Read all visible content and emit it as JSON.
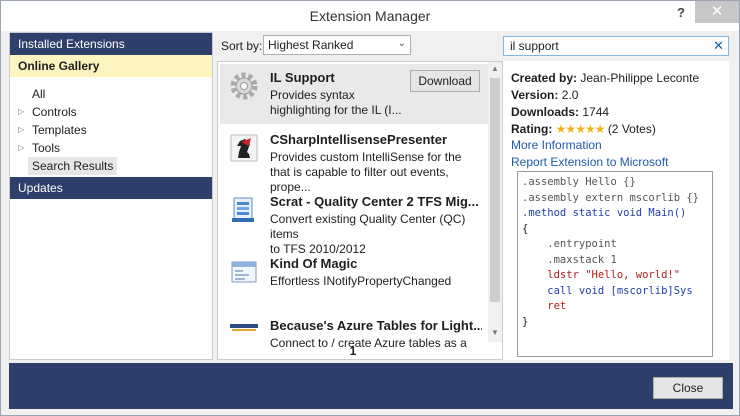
{
  "window": {
    "title": "Extension Manager",
    "help": "?",
    "close": "✕"
  },
  "nav": {
    "installed": "Installed Extensions",
    "online": "Online Gallery",
    "tree": [
      {
        "label": "All",
        "expandable": false,
        "selected": false
      },
      {
        "label": "Controls",
        "expandable": true,
        "selected": false
      },
      {
        "label": "Templates",
        "expandable": true,
        "selected": false
      },
      {
        "label": "Tools",
        "expandable": true,
        "selected": false
      },
      {
        "label": "Search Results",
        "expandable": false,
        "selected": true
      }
    ],
    "updates": "Updates"
  },
  "sort": {
    "label": "Sort by:",
    "value": "Highest Ranked"
  },
  "search": {
    "value": "il support",
    "clear": "✕"
  },
  "results": {
    "items": [
      {
        "title": "IL Support",
        "desc1": "Provides syntax",
        "desc2": "highlighting for the IL (I...",
        "icon": "gear-icon",
        "button": "Download"
      },
      {
        "title": "CSharpIntellisensePresenter",
        "desc1": "Provides custom IntelliSense for the",
        "desc2": "that is capable to filter out events, prope...",
        "icon": "chess-knight-icon"
      },
      {
        "title": "Scrat - Quality Center 2 TFS Mig...",
        "desc1": "Convert existing Quality Center (QC) items",
        "desc2": "to TFS 2010/2012",
        "icon": "migration-icon"
      },
      {
        "title": "Kind Of Magic",
        "desc1": "Effortless INotifyPropertyChanged",
        "desc2": "",
        "icon": "window-icon"
      },
      {
        "title": "Because's Azure Tables for Light...",
        "desc1": "Connect to / create Azure tables as a",
        "desc2": "",
        "icon": "azure-logo-icon"
      }
    ],
    "page": "1"
  },
  "details": {
    "created_label": "Created by:",
    "created_value": "Jean-Philippe Leconte",
    "version_label": "Version:",
    "version_value": "2.0",
    "downloads_label": "Downloads:",
    "downloads_value": "1744",
    "rating_label": "Rating:",
    "rating_stars": "★★★★★",
    "rating_votes": "(2 Votes)",
    "more_info": "More Information",
    "report": "Report Extension to Microsoft"
  },
  "code": [
    ".assembly Hello {}",
    ".assembly extern mscorlib {}",
    ".method static void Main()",
    "{",
    "    .entrypoint",
    "    .maxstack 1",
    "    ldstr \"Hello, world!\"",
    "    call void [mscorlib]Sys",
    "    ret",
    "}"
  ],
  "footer": {
    "close": "Close"
  },
  "colors": {
    "accent_dark": "#2f3f6b",
    "selection": "#fdf4bf",
    "link": "#1e5aa8",
    "star": "#f2b21c"
  }
}
